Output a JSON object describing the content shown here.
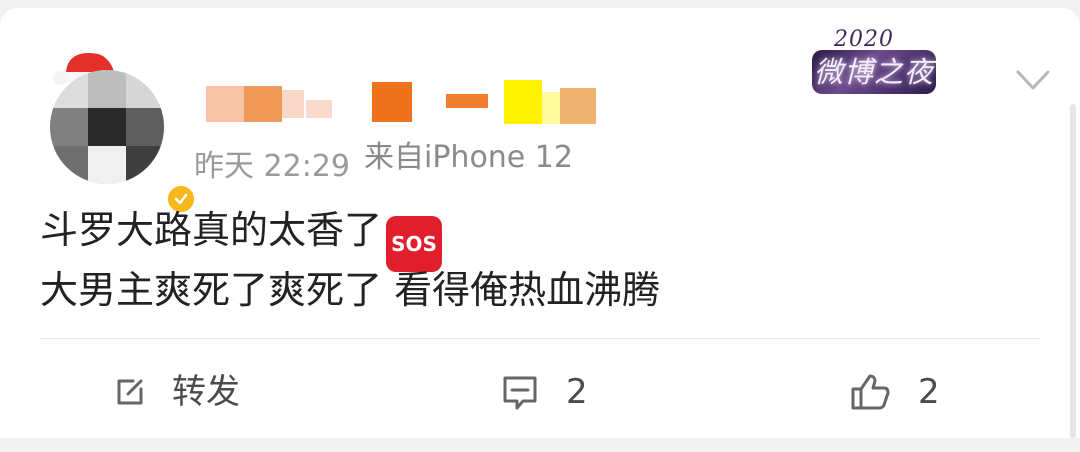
{
  "post": {
    "meta": {
      "time": "昨天 22:29",
      "source": "来自iPhone 12"
    },
    "badge": {
      "year": "2020",
      "title": "微博之夜"
    },
    "content": {
      "line1": "斗罗大路真的太香了",
      "emoji_text": "SOS",
      "line2": "大男主爽死了爽死了 看得俺热血沸腾"
    }
  },
  "actions": {
    "repost_label": "转发",
    "comment_count": "2",
    "like_count": "2"
  },
  "icons": {
    "repost": "edit-square-icon",
    "comment": "comment-icon",
    "like": "thumbs-up-icon",
    "more": "chevron-down-icon",
    "verified": "check-icon"
  },
  "colors": {
    "background": "#f2f2f2",
    "card": "#ffffff",
    "text": "#222222",
    "muted": "#8a8a8a",
    "verified": "#f6b91c",
    "sos": "#e11f2c"
  }
}
